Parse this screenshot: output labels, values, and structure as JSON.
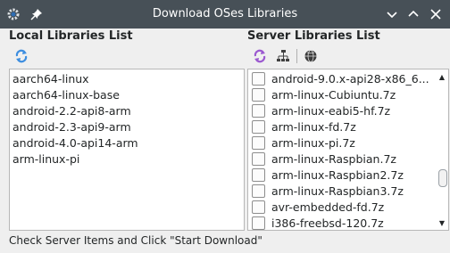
{
  "window": {
    "title": "Download OSes Libraries",
    "icons": [
      "app-gear-icon",
      "pin-icon",
      "chevron-down-icon",
      "chevron-up-icon",
      "close-icon"
    ]
  },
  "local": {
    "title": "Local Libraries List",
    "items": [
      "aarch64-linux",
      "aarch64-linux-base",
      "android-2.2-api8-arm",
      "android-2.3-api9-arm",
      "android-4.0-api14-arm",
      "arm-linux-pi"
    ]
  },
  "server": {
    "title": "Server Libraries List",
    "items": [
      "android-9.0.x-api28-x86_6...",
      "arm-linux-Cubiuntu.7z",
      "arm-linux-eabi5-hf.7z",
      "arm-linux-fd.7z",
      "arm-linux-pi.7z",
      "arm-linux-Raspbian.7z",
      "arm-linux-Raspbian2.7z",
      "arm-linux-Raspbian3.7z",
      "avr-embedded-fd.7z",
      "i386-freebsd-120.7z"
    ]
  },
  "status": "Check Server Items and Click \"Start Download\"",
  "colors": {
    "titlebar": "#475057",
    "background": "#efefef",
    "refresh": "#3d8ee0",
    "download": "#9b59d0"
  }
}
